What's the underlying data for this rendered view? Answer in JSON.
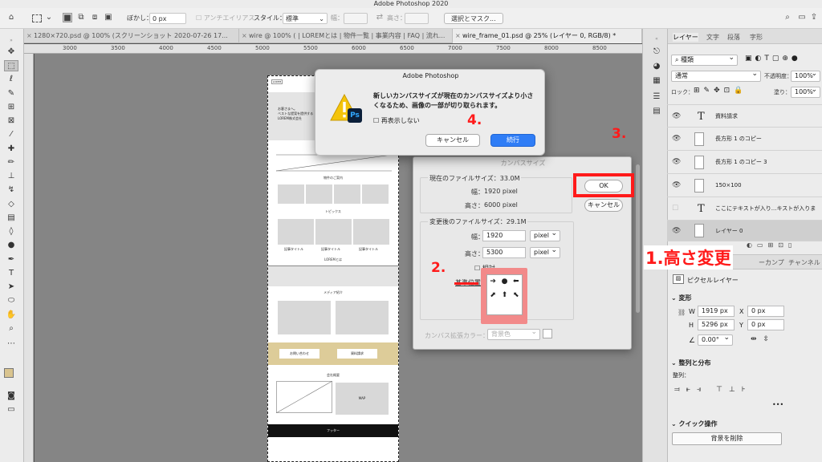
{
  "app_title": "Adobe Photoshop 2020",
  "options": {
    "blur_label": "ぼかし：",
    "blur_value": "0 px",
    "antialias_label": "アンチエイリアス",
    "style_label": "スタイル：",
    "style_value": "標準",
    "width_label": "幅：",
    "height_label": "高さ：",
    "select_mask_label": "選択とマスク..."
  },
  "tabs": [
    {
      "label": "1280×720.psd @ 100% (スクリーンショット 2020-07-26 17..."
    },
    {
      "label": "wire @ 100% ( | LOREMとは | 物件一覧 | 事業内容 | FAQ | 流れ..."
    },
    {
      "label": "wire_frame_01.psd @ 25% (レイヤー 0, RGB/8) *"
    }
  ],
  "ruler_ticks": [
    "3000",
    "3500",
    "4000",
    "4500",
    "5000",
    "5500",
    "6000",
    "6500",
    "7000",
    "7500",
    "8000",
    "8500"
  ],
  "document": {
    "logo": "LOREM",
    "hero_text": "お客さまへ。\nベストな提案を提供する\nLOREM株式会社",
    "section1": "物件のご案内",
    "section2": "トピックス",
    "item_title": "記事タイトル",
    "section3": "LOREMとは",
    "section4": "メディア紹介",
    "contact_btn": "お問い合わせ",
    "request_btn": "資料請求",
    "section5": "会社概要",
    "map_label": "MAP",
    "footer": "フッター"
  },
  "alert": {
    "title": "Adobe Photoshop",
    "message": "新しいカンバスサイズが現在のカンバスサイズより小さくなるため、画像の一部が切り取られます。",
    "checkbox_label": "再表示しない",
    "cancel": "キャンセル",
    "proceed": "続行",
    "ps_badge": "Ps"
  },
  "canvas_size_dialog": {
    "title": "カンバスサイズ",
    "current_size_label": "現在のファイルサイズ：33.0M",
    "current_width_label": "幅：",
    "current_width": "1920 pixel",
    "current_height_label": "高さ：",
    "current_height": "6000 pixel",
    "new_size_label": "変更後のファイルサイズ：29.1M",
    "new_width_label": "幅：",
    "new_width": "1920",
    "new_height_label": "高さ：",
    "new_height": "5300",
    "unit": "pixel",
    "relative_label": "相対",
    "anchor_label": "基準位置：",
    "ext_color_label": "カンバス拡張カラー：",
    "ext_color_value": "背景色",
    "ok": "OK",
    "cancel": "キャンセル"
  },
  "annotations": {
    "step1": "1.高さ変更",
    "step2": "2.",
    "step3": "3.",
    "step4": "4."
  },
  "right_panel": {
    "tabs": [
      "レイヤー",
      "文字",
      "段落",
      "字形"
    ],
    "kind_label": "種類",
    "blend_mode": "通常",
    "opacity_label": "不透明度：",
    "opacity_value": "100%",
    "lock_label": "ロック：",
    "fill_label": "塗り：",
    "fill_value": "100%",
    "layers": [
      {
        "name": "資料請求",
        "kind": "text"
      },
      {
        "name": "長方形 1 のコピー",
        "kind": "shape"
      },
      {
        "name": "長方形 1 のコピー 3",
        "kind": "shape"
      },
      {
        "name": "150×100",
        "kind": "shape"
      },
      {
        "name": "ここにテキストが入り...キストが入ります。",
        "kind": "text"
      },
      {
        "name": "レイヤー 0",
        "kind": "pixel"
      }
    ],
    "props_tabs_left": "ーカンプ",
    "props_tab_channel": "チャンネル",
    "pixel_layer_label": "ピクセルレイヤー",
    "transform_label": "変形",
    "w_label": "W",
    "w_value": "1919 px",
    "h_label": "H",
    "h_value": "5296 px",
    "x_label": "X",
    "x_value": "0 px",
    "y_label": "Y",
    "y_value": "0 px",
    "angle_value": "0.00°",
    "align_label": "整列と分布",
    "align_sub": "整列：",
    "quick_label": "クイック操作",
    "remove_bg": "背景を削除",
    "more": "•••"
  }
}
